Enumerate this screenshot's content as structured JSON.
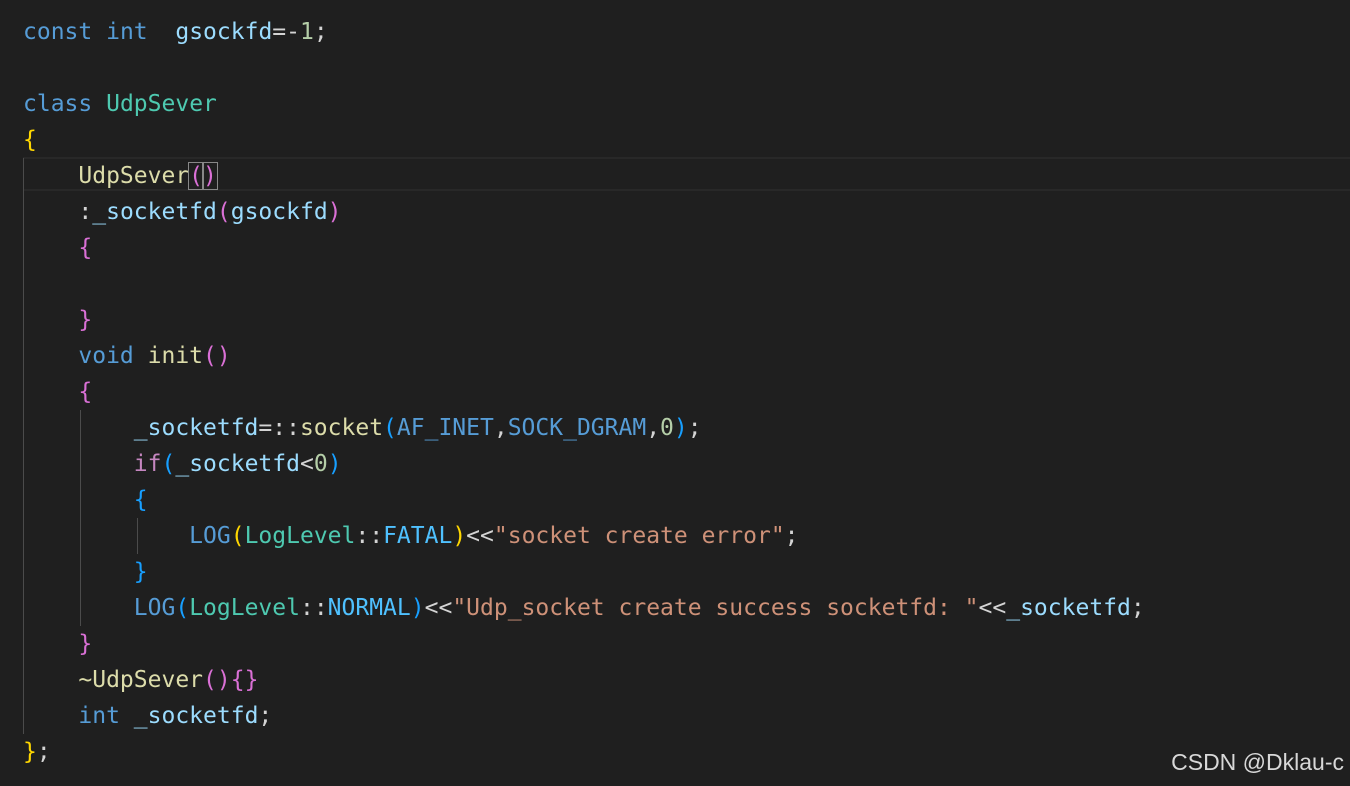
{
  "colors": {
    "background": "#1f1f1f",
    "keyword": "#569cd6",
    "type": "#4ec9b0",
    "function": "#dcdcaa",
    "variable": "#9cdcfe",
    "constant": "#4fc1ff",
    "number": "#b5cea8",
    "string": "#ce9178",
    "control": "#c586c0",
    "bracket1": "#ffd700",
    "bracket2": "#da70d6",
    "bracket3": "#179fff",
    "operator": "#d4d4d4",
    "guide": "#4b4b4b"
  },
  "code": {
    "lines": [
      {
        "indent": 0,
        "tokens": [
          {
            "t": "const",
            "k": "keyword"
          },
          {
            "t": " "
          },
          {
            "t": "int",
            "k": "keyword"
          },
          {
            "t": "  "
          },
          {
            "t": "gsockfd",
            "k": "variable"
          },
          {
            "t": "=-",
            "k": "operator"
          },
          {
            "t": "1",
            "k": "number"
          },
          {
            "t": ";",
            "k": "operator"
          }
        ]
      },
      {
        "indent": 0,
        "tokens": []
      },
      {
        "indent": 0,
        "tokens": [
          {
            "t": "class",
            "k": "keyword"
          },
          {
            "t": " "
          },
          {
            "t": "UdpSever",
            "k": "type"
          }
        ]
      },
      {
        "indent": 0,
        "tokens": [
          {
            "t": "{",
            "k": "bracket1"
          }
        ]
      },
      {
        "indent": 1,
        "tokens": [
          {
            "t": "UdpSever",
            "k": "function"
          },
          {
            "t": "(",
            "k": "bracket2",
            "box": true
          },
          {
            "t": ")",
            "k": "bracket2",
            "box": true
          }
        ]
      },
      {
        "indent": 1,
        "tokens": [
          {
            "t": ":",
            "k": "operator"
          },
          {
            "t": "_socketfd",
            "k": "variable"
          },
          {
            "t": "(",
            "k": "bracket2"
          },
          {
            "t": "gsockfd",
            "k": "variable"
          },
          {
            "t": ")",
            "k": "bracket2"
          }
        ]
      },
      {
        "indent": 1,
        "tokens": [
          {
            "t": "{",
            "k": "bracket2"
          }
        ]
      },
      {
        "indent": 1,
        "tokens": []
      },
      {
        "indent": 1,
        "tokens": [
          {
            "t": "}",
            "k": "bracket2"
          }
        ]
      },
      {
        "indent": 1,
        "tokens": [
          {
            "t": "void",
            "k": "keyword"
          },
          {
            "t": " "
          },
          {
            "t": "init",
            "k": "function"
          },
          {
            "t": "()",
            "k": "bracket2"
          }
        ]
      },
      {
        "indent": 1,
        "tokens": [
          {
            "t": "{",
            "k": "bracket2"
          }
        ]
      },
      {
        "indent": 2,
        "tokens": [
          {
            "t": "_socketfd",
            "k": "variable"
          },
          {
            "t": "=::",
            "k": "operator"
          },
          {
            "t": "socket",
            "k": "function"
          },
          {
            "t": "(",
            "k": "bracket3"
          },
          {
            "t": "AF_INET",
            "k": "keyword"
          },
          {
            "t": ",",
            "k": "operator"
          },
          {
            "t": "SOCK_DGRAM",
            "k": "keyword"
          },
          {
            "t": ",",
            "k": "operator"
          },
          {
            "t": "0",
            "k": "number"
          },
          {
            "t": ")",
            "k": "bracket3"
          },
          {
            "t": ";",
            "k": "operator"
          }
        ]
      },
      {
        "indent": 2,
        "tokens": [
          {
            "t": "if",
            "k": "control"
          },
          {
            "t": "(",
            "k": "bracket3"
          },
          {
            "t": "_socketfd",
            "k": "variable"
          },
          {
            "t": "<",
            "k": "operator"
          },
          {
            "t": "0",
            "k": "number"
          },
          {
            "t": ")",
            "k": "bracket3"
          }
        ]
      },
      {
        "indent": 2,
        "tokens": [
          {
            "t": "{",
            "k": "bracket3"
          }
        ]
      },
      {
        "indent": 3,
        "tokens": [
          {
            "t": "LOG",
            "k": "keyword"
          },
          {
            "t": "(",
            "k": "bracket1"
          },
          {
            "t": "LogLevel",
            "k": "type"
          },
          {
            "t": "::",
            "k": "operator"
          },
          {
            "t": "FATAL",
            "k": "constant"
          },
          {
            "t": ")",
            "k": "bracket1"
          },
          {
            "t": "<<",
            "k": "operator"
          },
          {
            "t": "\"socket create error\"",
            "k": "string"
          },
          {
            "t": ";",
            "k": "operator"
          }
        ]
      },
      {
        "indent": 2,
        "tokens": [
          {
            "t": "}",
            "k": "bracket3"
          }
        ]
      },
      {
        "indent": 2,
        "tokens": [
          {
            "t": "LOG",
            "k": "keyword"
          },
          {
            "t": "(",
            "k": "bracket3"
          },
          {
            "t": "LogLevel",
            "k": "type"
          },
          {
            "t": "::",
            "k": "operator"
          },
          {
            "t": "NORMAL",
            "k": "constant"
          },
          {
            "t": ")",
            "k": "bracket3"
          },
          {
            "t": "<<",
            "k": "operator"
          },
          {
            "t": "\"Udp_socket create success socketfd: \"",
            "k": "string"
          },
          {
            "t": "<<",
            "k": "operator"
          },
          {
            "t": "_socketfd",
            "k": "variable"
          },
          {
            "t": ";",
            "k": "operator"
          }
        ]
      },
      {
        "indent": 1,
        "tokens": [
          {
            "t": "}",
            "k": "bracket2"
          }
        ]
      },
      {
        "indent": 1,
        "tokens": [
          {
            "t": "~UdpSever",
            "k": "function"
          },
          {
            "t": "()",
            "k": "bracket2"
          },
          {
            "t": "{}",
            "k": "bracket2"
          }
        ]
      },
      {
        "indent": 1,
        "tokens": [
          {
            "t": "int",
            "k": "keyword"
          },
          {
            "t": " "
          },
          {
            "t": "_socketfd",
            "k": "variable"
          },
          {
            "t": ";",
            "k": "operator"
          }
        ]
      },
      {
        "indent": 0,
        "tokens": [
          {
            "t": "}",
            "k": "bracket1"
          },
          {
            "t": ";",
            "k": "operator"
          }
        ]
      }
    ]
  },
  "watermark": {
    "text": "CSDN @Dklau-c"
  }
}
